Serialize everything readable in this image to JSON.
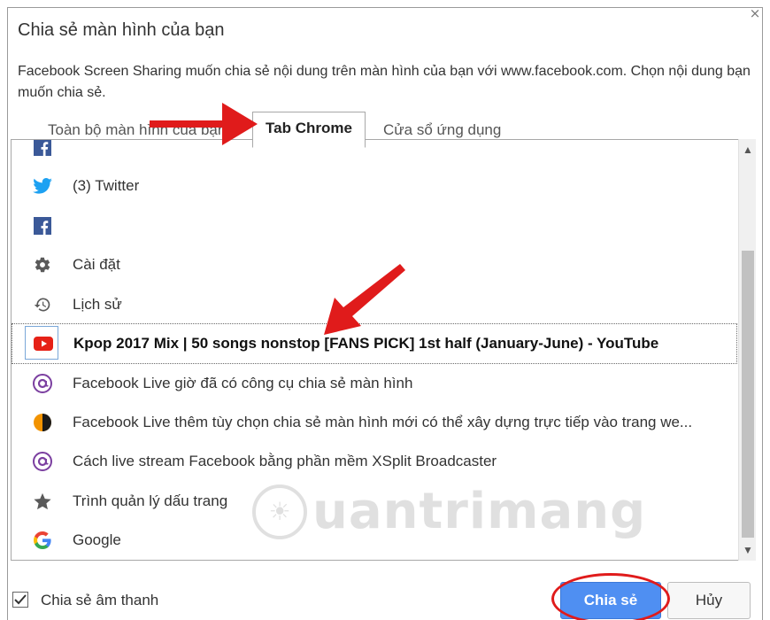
{
  "dialog": {
    "title": "Chia sẻ màn hình của bạn",
    "description": "Facebook Screen Sharing muốn chia sẻ nội dung trên màn hình của bạn với www.facebook.com. Chọn nội dung bạn muốn chia sẻ.",
    "close_glyph": "×"
  },
  "tabs": [
    {
      "label": "Toàn bộ màn hình của bạn",
      "active": false
    },
    {
      "label": "Tab Chrome",
      "active": true
    },
    {
      "label": "Cửa sổ ứng dụng",
      "active": false
    }
  ],
  "list": {
    "items": [
      {
        "label": "",
        "icon": "facebook-icon"
      },
      {
        "label": "(3) Twitter",
        "icon": "twitter-icon"
      },
      {
        "label": "",
        "icon": "facebook-icon"
      },
      {
        "label": "Cài đặt",
        "icon": "gear-icon"
      },
      {
        "label": "Lịch sử",
        "icon": "history-icon"
      },
      {
        "label": "Kpop 2017 Mix | 50 songs nonstop [FANS PICK] 1st half (January-June) - YouTube",
        "icon": "youtube-icon",
        "selected": true
      },
      {
        "label": "Facebook Live giờ đã có công cụ chia sẻ màn hình",
        "icon": "at-sign-icon"
      },
      {
        "label": "Facebook Live thêm tùy chọn chia sẻ màn hình mới có thể xây dựng trực tiếp vào trang we...",
        "icon": "half-circle-icon"
      },
      {
        "label": "Cách live stream Facebook bằng phần mềm XSplit Broadcaster",
        "icon": "at-sign-icon"
      },
      {
        "label": "Trình quản lý dấu trang",
        "icon": "star-icon"
      },
      {
        "label": "Google",
        "icon": "google-icon"
      }
    ]
  },
  "footer": {
    "share_audio_label": "Chia sẻ âm thanh",
    "share_audio_checked": true,
    "share_button": "Chia sẻ",
    "cancel_button": "Hủy"
  },
  "watermark": {
    "text": "uantrimang"
  },
  "colors": {
    "share_button_bg": "#4f8ff2",
    "annotation_red": "#e01b1b",
    "facebook_blue": "#3b5998",
    "twitter_blue": "#1da1f2",
    "youtube_red": "#e62117"
  }
}
